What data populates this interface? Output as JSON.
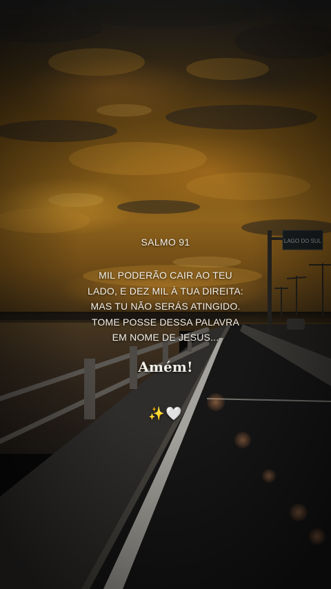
{
  "post": {
    "title": "SALMO 91",
    "verse_lines": [
      "MIL PODERÃO CAIR AO TEU",
      "LADO, E DEZ MIL À TUA DIREITA:",
      "MAS TU NÃO SERÁS ATINGIDO.",
      "TOME POSSE DESSA PALAVRA",
      "EM NOME DE JESUS..."
    ],
    "closing": "Amém!",
    "emojis": {
      "sparkles": "✨",
      "heart": "🤍"
    }
  },
  "scene": {
    "road_sign_text": "LAGO DO SUL",
    "colors": {
      "sky_gold": "#b07a22",
      "sky_dark": "#2a2b2c",
      "road": "#1c1b1a",
      "text": "#f4f1ea"
    }
  }
}
